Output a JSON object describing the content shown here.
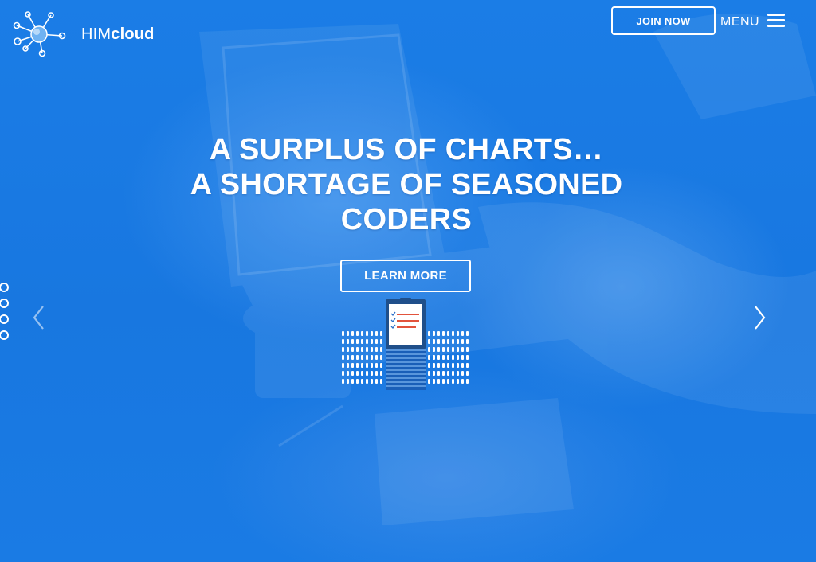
{
  "brand": {
    "name_prefix": "HIM",
    "name_suffix": "cloud"
  },
  "header": {
    "join_label": "JOIN NOW",
    "menu_label": "MENU"
  },
  "hero": {
    "headline": [
      "A SURPLUS OF CHARTS…",
      "A SHORTAGE OF SEASONED",
      "CODERS"
    ],
    "cta_label": "LEARN MORE"
  },
  "slider": {
    "dot_count": 4
  },
  "colors": {
    "background": "#1a78e0",
    "text": "#ffffff",
    "accent_red": "#e2533c"
  }
}
